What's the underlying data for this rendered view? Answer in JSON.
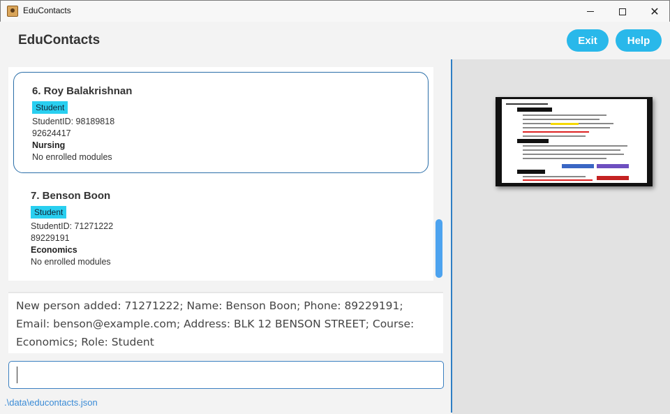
{
  "window": {
    "title": "EduContacts"
  },
  "header": {
    "app_name": "EduContacts",
    "exit_label": "Exit",
    "help_label": "Help"
  },
  "contacts": [
    {
      "index_name": "6.  Roy Balakrishnan",
      "role": "Student",
      "student_id": "StudentID: 98189818",
      "phone": "92624417",
      "course": "Nursing",
      "modules": "No enrolled modules",
      "selected": true
    },
    {
      "index_name": "7.  Benson Boon",
      "role": "Student",
      "student_id": "StudentID: 71271222",
      "phone": "89229191",
      "course": "Economics",
      "modules": "No enrolled modules",
      "selected": false
    }
  ],
  "result": {
    "message": "New person added: 71271222; Name: Benson Boon; Phone: 89229191; Email: benson@example.com; Address: BLK 12 BENSON STREET; Course: Economics; Role: Student"
  },
  "command": {
    "value": ""
  },
  "status": {
    "file_path": ".\\data\\educontacts.json"
  },
  "colors": {
    "accent": "#29b8ea",
    "role_tag": "#29cff0",
    "divider": "#2e7ec4",
    "scroll_thumb": "#4da3ef"
  }
}
